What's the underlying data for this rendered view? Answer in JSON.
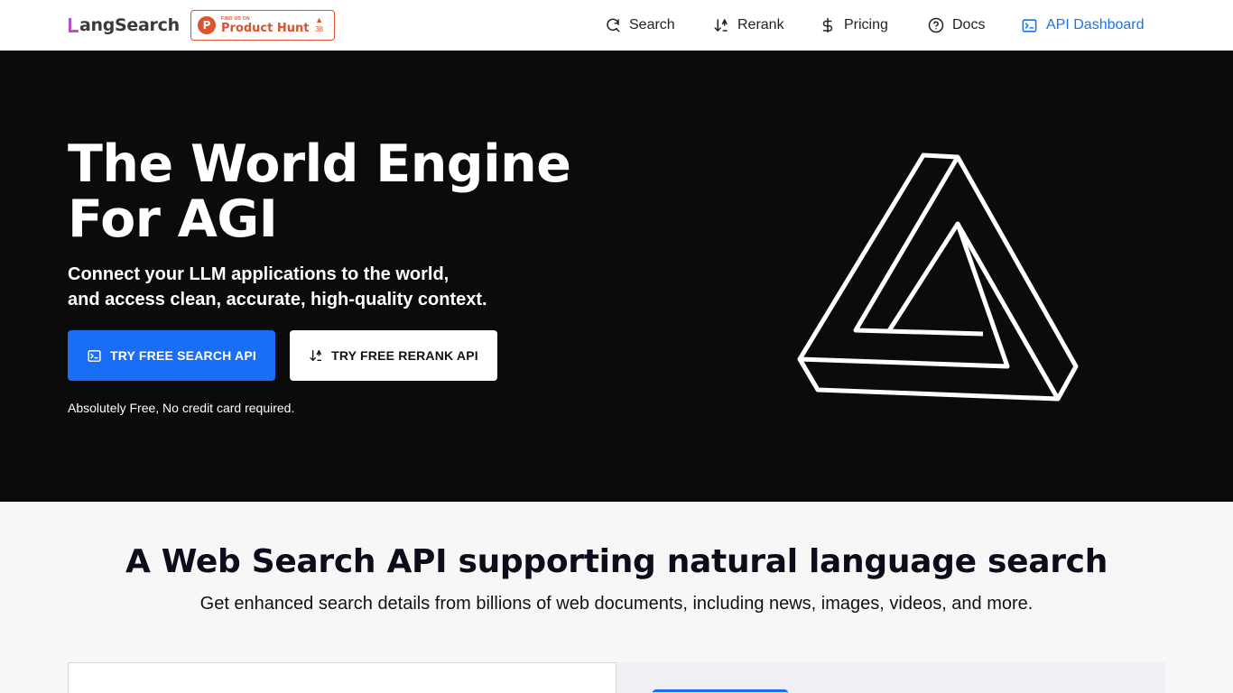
{
  "header": {
    "logo_text": "angSearch",
    "logo_letter": "L",
    "product_hunt": {
      "small": "FIND US ON",
      "big": "Product Hunt",
      "count": "38",
      "arrow": "▲",
      "initial": "P"
    },
    "nav": [
      {
        "label": "Search",
        "icon": "search-refresh-icon"
      },
      {
        "label": "Rerank",
        "icon": "sort-arrows-icon"
      },
      {
        "label": "Pricing",
        "icon": "dollar-icon"
      },
      {
        "label": "Docs",
        "icon": "help-circle-icon"
      },
      {
        "label": "API Dashboard",
        "icon": "terminal-icon"
      }
    ]
  },
  "hero": {
    "title_line1": "The World Engine",
    "title_line2": "For AGI",
    "subtitle_line1": "Connect your LLM applications to the world,",
    "subtitle_line2": "and access clean, accurate, high-quality context.",
    "primary_button": "TRY FREE SEARCH API",
    "secondary_button": "TRY FREE RERANK API",
    "note": "Absolutely Free, No credit card required."
  },
  "section": {
    "title": "A Web Search API supporting natural language search",
    "subtitle": "Get enhanced search details from billions of web documents, including news, images, videos, and more."
  },
  "colors": {
    "accent": "#1a6ef5",
    "active_nav": "#1a73e8",
    "product_hunt": "#da552f",
    "hero_bg": "#0b0b0b"
  }
}
